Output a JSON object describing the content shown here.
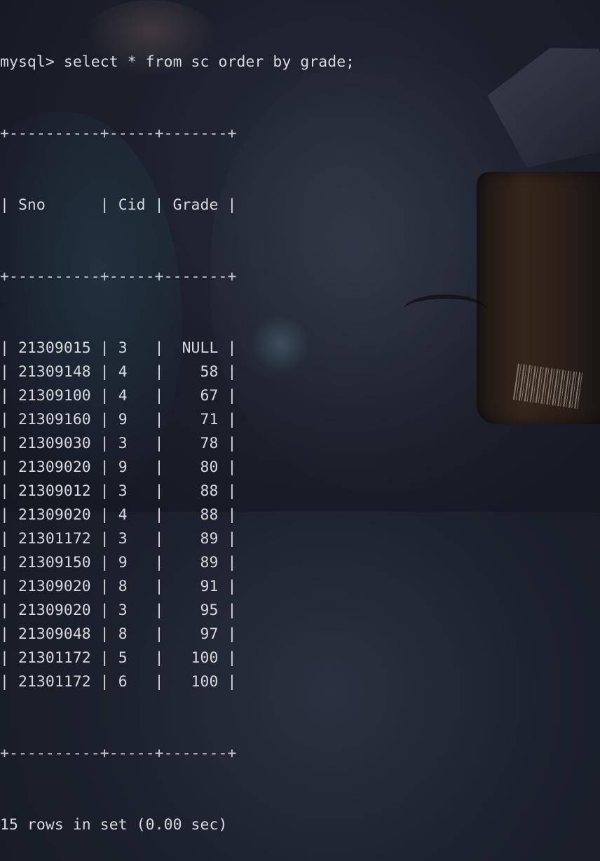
{
  "terminal": {
    "prompt": "mysql> ",
    "command": "select * from sc order by grade;",
    "border": "+----------+-----+-------+",
    "headers": {
      "sno": "Sno",
      "cid": "Cid",
      "grade": "Grade"
    },
    "rows": [
      {
        "sno": "21309015",
        "cid": "3",
        "grade": "NULL"
      },
      {
        "sno": "21309148",
        "cid": "4",
        "grade": "58"
      },
      {
        "sno": "21309100",
        "cid": "4",
        "grade": "67"
      },
      {
        "sno": "21309160",
        "cid": "9",
        "grade": "71"
      },
      {
        "sno": "21309030",
        "cid": "3",
        "grade": "78"
      },
      {
        "sno": "21309020",
        "cid": "9",
        "grade": "80"
      },
      {
        "sno": "21309012",
        "cid": "3",
        "grade": "88"
      },
      {
        "sno": "21309020",
        "cid": "4",
        "grade": "88"
      },
      {
        "sno": "21301172",
        "cid": "3",
        "grade": "89"
      },
      {
        "sno": "21309150",
        "cid": "9",
        "grade": "89"
      },
      {
        "sno": "21309020",
        "cid": "8",
        "grade": "91"
      },
      {
        "sno": "21309020",
        "cid": "3",
        "grade": "95"
      },
      {
        "sno": "21309048",
        "cid": "8",
        "grade": "97"
      },
      {
        "sno": "21301172",
        "cid": "5",
        "grade": "100"
      },
      {
        "sno": "21301172",
        "cid": "6",
        "grade": "100"
      }
    ],
    "status": "15 rows in set (0.00 sec)"
  }
}
